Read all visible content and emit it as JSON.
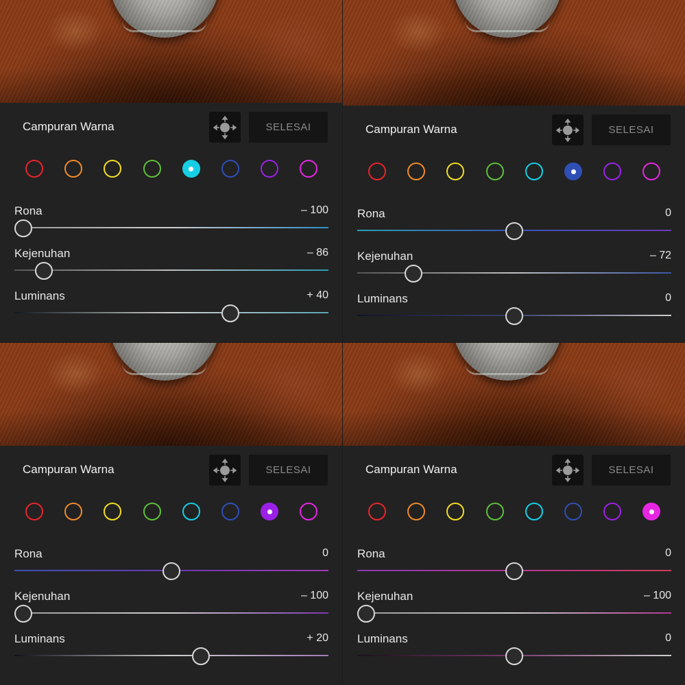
{
  "panels": [
    {
      "title": "Campuran Warna",
      "done_label": "SELESAI",
      "swatches": [
        "#e8242a",
        "#ef8a2a",
        "#f3dc22",
        "#5fbf3c",
        "#16cfe5",
        "#2f4fb7",
        "#9b21e6",
        "#e626e3"
      ],
      "selected_swatch": 4,
      "sliders": [
        {
          "label": "Rona",
          "value": "– 100",
          "fraction": 0.0,
          "colors": [
            "#9a9a9a",
            "#cfcfcf",
            "#2e8ec9"
          ]
        },
        {
          "label": "Kejenuhan",
          "value": "– 86",
          "fraction": 0.07,
          "colors": [
            "#555555",
            "#bfbfbf",
            "#2a9db5"
          ]
        },
        {
          "label": "Luminans",
          "value": "+ 40",
          "fraction": 0.7,
          "colors": [
            "#101a1c",
            "#cfcfcf",
            "#5aa6b5"
          ]
        }
      ]
    },
    {
      "title": "Campuran Warna",
      "done_label": "SELESAI",
      "swatches": [
        "#e8242a",
        "#ef8a2a",
        "#f3dc22",
        "#5fbf3c",
        "#16cfe5",
        "#2f4fb7",
        "#9b21e6",
        "#e626e3"
      ],
      "selected_swatch": 5,
      "sliders": [
        {
          "label": "Rona",
          "value": "0",
          "fraction": 0.5,
          "colors": [
            "#2aa0b5",
            "#3a55b5",
            "#6a3ab5"
          ]
        },
        {
          "label": "Kejenuhan",
          "value": "– 72",
          "fraction": 0.16,
          "colors": [
            "#555555",
            "#bfbfbf",
            "#3a55a5"
          ]
        },
        {
          "label": "Luminans",
          "value": "0",
          "fraction": 0.5,
          "colors": [
            "#101524",
            "#3a4070",
            "#cfcfcf"
          ]
        }
      ]
    },
    {
      "title": "Campuran Warna",
      "done_label": "SELESAI",
      "swatches": [
        "#e8242a",
        "#ef8a2a",
        "#f3dc22",
        "#5fbf3c",
        "#16cfe5",
        "#2f4fb7",
        "#9b21e6",
        "#e626e3"
      ],
      "selected_swatch": 6,
      "sliders": [
        {
          "label": "Rona",
          "value": "0",
          "fraction": 0.5,
          "colors": [
            "#3a4fb5",
            "#6a3ab5",
            "#a23ab5"
          ]
        },
        {
          "label": "Kejenuhan",
          "value": "– 100",
          "fraction": 0.0,
          "colors": [
            "#9a9a9a",
            "#cfcfcf",
            "#7a38b0"
          ]
        },
        {
          "label": "Luminans",
          "value": "+ 20",
          "fraction": 0.6,
          "colors": [
            "#140f1a",
            "#cfcfcf",
            "#a07ab5"
          ]
        }
      ]
    },
    {
      "title": "Campuran Warna",
      "done_label": "SELESAI",
      "swatches": [
        "#e8242a",
        "#ef8a2a",
        "#f3dc22",
        "#5fbf3c",
        "#16cfe5",
        "#2f4fb7",
        "#9b21e6",
        "#e626e3"
      ],
      "selected_swatch": 7,
      "sliders": [
        {
          "label": "Rona",
          "value": "0",
          "fraction": 0.5,
          "colors": [
            "#8a38b5",
            "#b5388f",
            "#d03a5a"
          ]
        },
        {
          "label": "Kejenuhan",
          "value": "– 100",
          "fraction": 0.0,
          "colors": [
            "#9a9a9a",
            "#cfcfcf",
            "#b0388f"
          ]
        },
        {
          "label": "Luminans",
          "value": "0",
          "fraction": 0.5,
          "colors": [
            "#1a101a",
            "#7a3a70",
            "#cfcfcf"
          ]
        }
      ]
    }
  ]
}
